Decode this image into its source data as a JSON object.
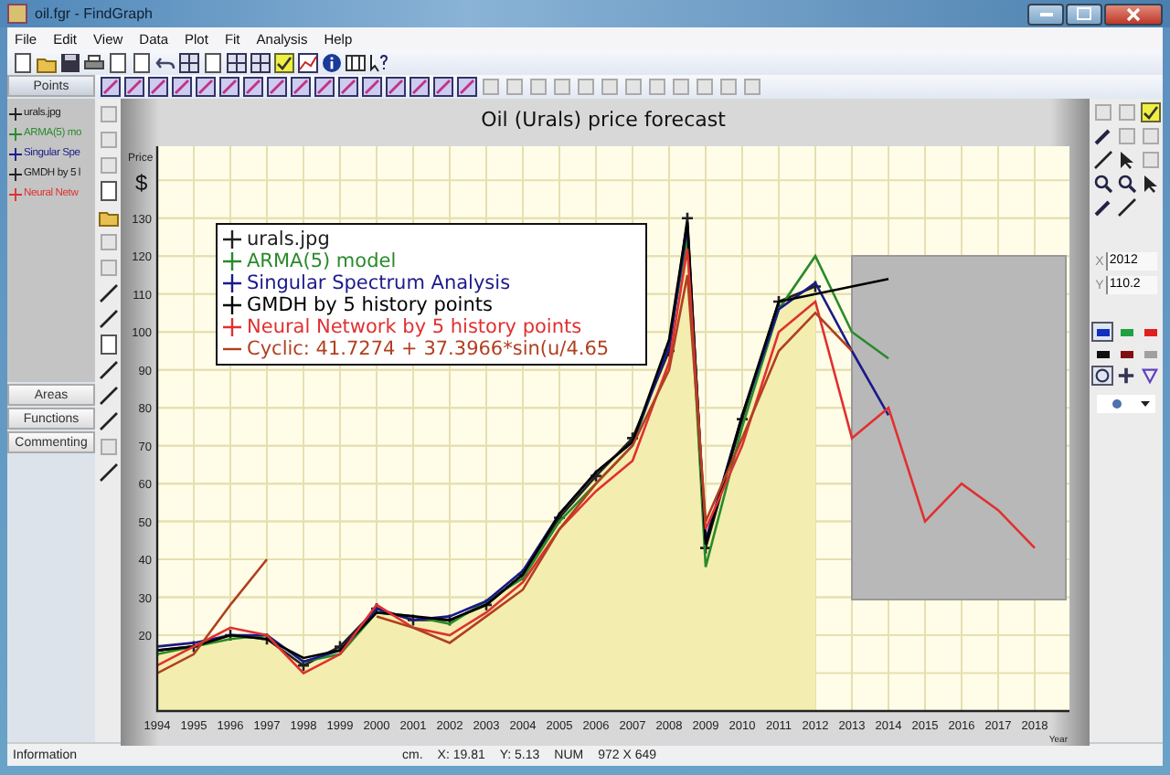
{
  "window": {
    "title": "oil.fgr - FindGraph"
  },
  "menu": [
    "File",
    "Edit",
    "View",
    "Data",
    "Plot",
    "Fit",
    "Analysis",
    "Help"
  ],
  "side_panel": {
    "sections": [
      {
        "label": "Points",
        "expanded": true
      },
      {
        "label": "Areas",
        "expanded": false
      },
      {
        "label": "Functions",
        "expanded": false
      },
      {
        "label": "Commenting",
        "expanded": false
      }
    ],
    "items": [
      {
        "label": "urals.jpg",
        "color": "#202020"
      },
      {
        "label": "ARMA(5) mo",
        "color": "#2a8a2a"
      },
      {
        "label": "Singular Spe",
        "color": "#1a1a8a"
      },
      {
        "label": "GMDH by 5 l",
        "color": "#202020"
      },
      {
        "label": "Neural Netw",
        "color": "#e03030"
      }
    ]
  },
  "chart": {
    "unit": "$",
    "chart_data": {
      "type": "line",
      "title": "Oil (Urals) price forecast",
      "xlabel": "Year",
      "ylabel": "Price",
      "x": [
        1994,
        1995,
        1996,
        1997,
        1998,
        1999,
        2000,
        2001,
        2002,
        2003,
        2004,
        2005,
        2006,
        2007,
        2008,
        2008.5,
        2009,
        2010,
        2011,
        2012,
        2013,
        2014,
        2015,
        2016,
        2017,
        2018
      ],
      "series": [
        {
          "name": "urals.jpg",
          "color": "#202020",
          "type": "area",
          "marker": "plus",
          "values": [
            16,
            17,
            20,
            19,
            12,
            17,
            27,
            24,
            24,
            28,
            36,
            51,
            62,
            72,
            95,
            130,
            43,
            77,
            108,
            112,
            null,
            null,
            null,
            null,
            null,
            null
          ]
        },
        {
          "name": "ARMA(5) model",
          "color": "#2a8a2a",
          "values": [
            15,
            17,
            19,
            20,
            13,
            15,
            26,
            25,
            23,
            29,
            35,
            50,
            60,
            70,
            97,
            125,
            38,
            75,
            106,
            120,
            100,
            93,
            null,
            null,
            null,
            null
          ]
        },
        {
          "name": "Singular Spectrum Analysis",
          "color": "#1a1a8a",
          "values": [
            17,
            18,
            20,
            20,
            13,
            16,
            27,
            24,
            25,
            29,
            37,
            52,
            63,
            71,
            96,
            128,
            45,
            78,
            106,
            113,
            95,
            78,
            null,
            null,
            null,
            null
          ]
        },
        {
          "name": "GMDH by 5 history points",
          "color": "#000000",
          "values": [
            16,
            17,
            20,
            19,
            14,
            16,
            26,
            25,
            24,
            28,
            36,
            52,
            63,
            71,
            98,
            129,
            44,
            78,
            108,
            110,
            112,
            114,
            null,
            null,
            null,
            null
          ]
        },
        {
          "name": "Neural Network by 5 history points",
          "color": "#e03030",
          "values": [
            12,
            17,
            22,
            20,
            10,
            15,
            28,
            22,
            20,
            26,
            34,
            48,
            58,
            66,
            92,
            122,
            48,
            70,
            100,
            108,
            72,
            80,
            50,
            60,
            53,
            43
          ]
        },
        {
          "name": "Cyclic:  41.7274 + 37.3966*sin(u/4.65",
          "color": "#b04020",
          "values": [
            10,
            15,
            28,
            40,
            null,
            null,
            25,
            22,
            18,
            25,
            32,
            48,
            60,
            70,
            90,
            115,
            50,
            72,
            95,
            105,
            95,
            null,
            null,
            null,
            null,
            null
          ]
        }
      ],
      "xlim": [
        1994,
        2018.95
      ],
      "ylim": [
        0,
        149
      ],
      "xticks": [
        1994,
        1995,
        1996,
        1997,
        1998,
        1999,
        2000,
        2001,
        2002,
        2003,
        2004,
        2005,
        2006,
        2007,
        2008,
        2009,
        2010,
        2011,
        2012,
        2013,
        2014,
        2015,
        2016,
        2017,
        2018
      ],
      "yticks": [
        20,
        30,
        40,
        50,
        60,
        70,
        80,
        90,
        100,
        110,
        120,
        130
      ],
      "grid": true,
      "legend": true
    },
    "forecast_panel": {
      "visible": true
    }
  },
  "coordinates": [
    {
      "label": "X",
      "value": "2012"
    },
    {
      "label": "Y",
      "value": "110.2"
    }
  ],
  "palette": [
    {
      "color": "#1030c0",
      "selected": true
    },
    {
      "color": "#20a040",
      "selected": false
    },
    {
      "color": "#e02020",
      "selected": false
    },
    {
      "color": "#101010",
      "selected": false
    },
    {
      "color": "#801010",
      "selected": false
    },
    {
      "color": "#a0a0a0",
      "selected": false
    }
  ],
  "marker_shapes": [
    {
      "kind": "circle",
      "selected": true
    },
    {
      "kind": "plus",
      "selected": false
    },
    {
      "kind": "triangle",
      "selected": false
    }
  ],
  "status_bar": {
    "info": "Information",
    "units": "cm.",
    "x": "X: 19.81",
    "y": "Y: 5.13",
    "num": "NUM",
    "size": "972 X 649"
  }
}
